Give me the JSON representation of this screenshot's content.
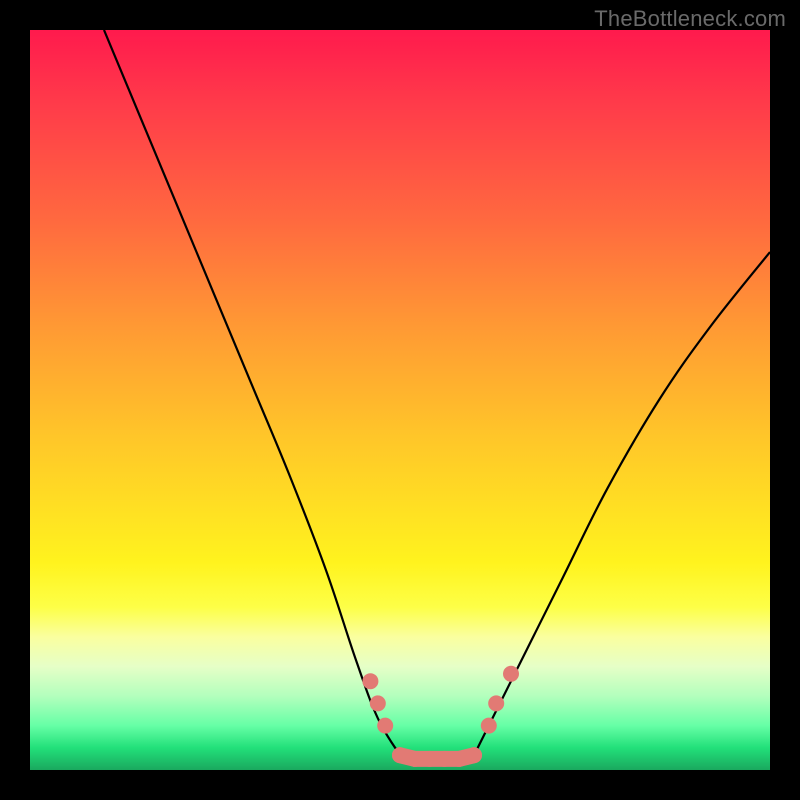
{
  "watermark": "TheBottleneck.com",
  "chart_data": {
    "type": "line",
    "title": "",
    "xlabel": "",
    "ylabel": "",
    "xlim": [
      0,
      100
    ],
    "ylim": [
      0,
      100
    ],
    "series": [
      {
        "name": "left-curve",
        "x": [
          10,
          15,
          20,
          25,
          30,
          35,
          40,
          44,
          47,
          50
        ],
        "y": [
          100,
          88,
          76,
          64,
          52,
          40,
          27,
          15,
          7,
          2
        ]
      },
      {
        "name": "right-curve",
        "x": [
          60,
          63,
          67,
          72,
          78,
          85,
          92,
          100
        ],
        "y": [
          2,
          8,
          16,
          26,
          38,
          50,
          60,
          70
        ]
      }
    ],
    "markers": {
      "name": "salmon-dots",
      "color": "#e27a74",
      "points": [
        {
          "x": 46,
          "y": 12
        },
        {
          "x": 47,
          "y": 9
        },
        {
          "x": 48,
          "y": 6
        },
        {
          "x": 50,
          "y": 2
        },
        {
          "x": 52,
          "y": 1.5
        },
        {
          "x": 54,
          "y": 1.5
        },
        {
          "x": 56,
          "y": 1.5
        },
        {
          "x": 58,
          "y": 1.5
        },
        {
          "x": 60,
          "y": 2
        },
        {
          "x": 62,
          "y": 6
        },
        {
          "x": 63,
          "y": 9
        },
        {
          "x": 65,
          "y": 13
        }
      ]
    },
    "gradient_stops": [
      {
        "pos": 0,
        "color": "#ff1a4d"
      },
      {
        "pos": 50,
        "color": "#ffc000"
      },
      {
        "pos": 80,
        "color": "#fff31e"
      },
      {
        "pos": 100,
        "color": "#1aa85e"
      }
    ]
  }
}
